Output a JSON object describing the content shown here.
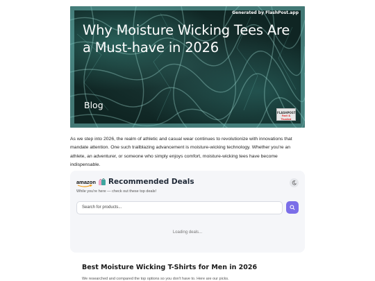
{
  "hero": {
    "credit": "Generated by FlashPost.app",
    "title": "Why Moisture Wicking Tees Are a Must-have in 2026",
    "tag": "Blog",
    "badge_line1": "FLASHPOST",
    "badge_line2": "Fast & Trusted"
  },
  "intro": {
    "text": "As we step into 2026, the realm of athletic and casual wear continues to revolutionize with innovations that mandate attention. One such trailblazing advancement is moisture-wicking technology. Whether you're an athlete, an adventurer, or someone who simply enjoys comfort, moisture-wicking tees have become indispensable."
  },
  "widget": {
    "brand": "amazon",
    "icon": "shopping-bags-icon",
    "title": "Recommended Deals",
    "subtitle": "While you're here — check out these top deals!",
    "theme_icon": "moon-icon",
    "search_placeholder": "Search for products...",
    "search_icon": "search-icon",
    "loading": "Loading deals...",
    "colors": {
      "accent": "#7b6ee8",
      "panel": "#f5f6f9"
    }
  },
  "section": {
    "title": "Best Moisture Wicking T-Shirts for Men in 2026",
    "text": "We researched and compared the top options so you don't have to. Here are our picks."
  }
}
